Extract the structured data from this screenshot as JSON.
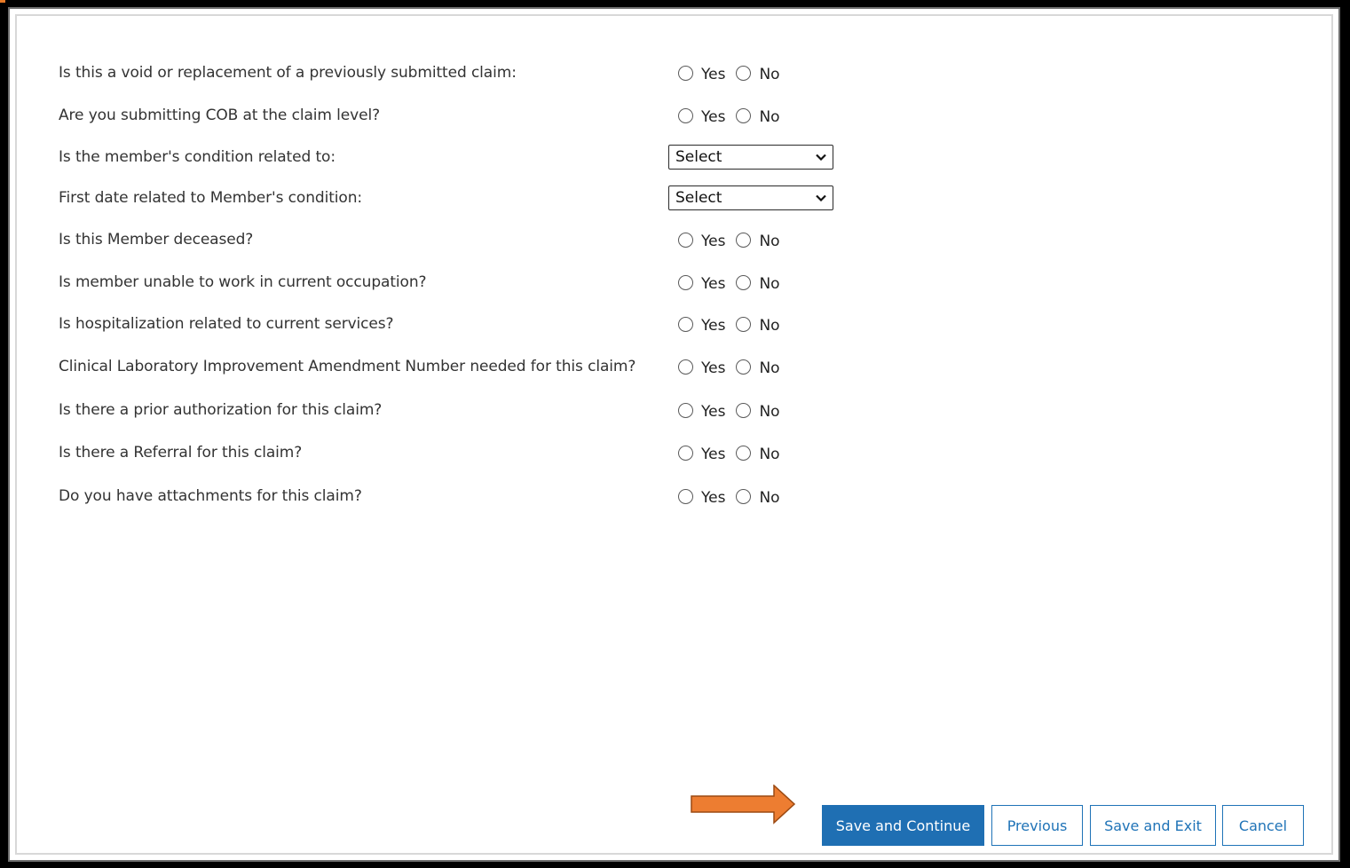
{
  "questions": [
    {
      "label": "Is this a void or replacement of a previously submitted claim:",
      "type": "radio",
      "yes": "Yes",
      "no": "No"
    },
    {
      "label": "Are you submitting COB at the claim level?",
      "type": "radio",
      "yes": "Yes",
      "no": "No"
    },
    {
      "label": "Is the member's condition related to:",
      "type": "select",
      "value": "Select"
    },
    {
      "label": "First date related to Member's condition:",
      "type": "select",
      "value": "Select"
    },
    {
      "label": "Is this Member deceased?",
      "type": "radio",
      "yes": "Yes",
      "no": "No"
    },
    {
      "label": "Is member unable to work in current occupation?",
      "type": "radio",
      "yes": "Yes",
      "no": "No"
    },
    {
      "label": "Is hospitalization related to current services?",
      "type": "radio",
      "yes": "Yes",
      "no": "No"
    },
    {
      "label": "Clinical Laboratory Improvement Amendment Number needed for this claim?",
      "type": "radio",
      "yes": "Yes",
      "no": "No"
    },
    {
      "label": "Is there a prior authorization for this claim?",
      "type": "radio",
      "yes": "Yes",
      "no": "No"
    },
    {
      "label": "Is there a Referral for this claim?",
      "type": "radio",
      "yes": "Yes",
      "no": "No"
    },
    {
      "label": "Do you have attachments for this claim?",
      "type": "radio",
      "yes": "Yes",
      "no": "No"
    }
  ],
  "buttons": {
    "save_continue": "Save and Continue",
    "previous": "Previous",
    "save_exit": "Save and Exit",
    "cancel": "Cancel"
  },
  "colors": {
    "primary": "#1f6fb3",
    "arrow": "#ed7d31",
    "text": "#333333"
  },
  "icons": {
    "pointer_arrow": "right-arrow-icon",
    "select_chevron": "chevron-down-icon"
  }
}
